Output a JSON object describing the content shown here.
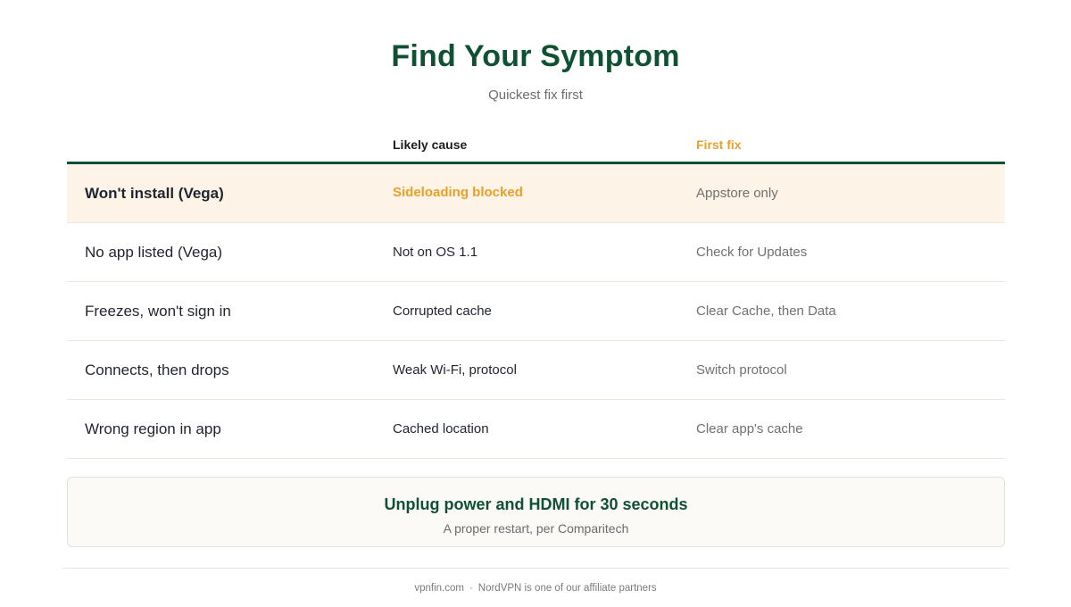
{
  "header": {
    "title": "Find Your Symptom",
    "subtitle": "Quickest fix first"
  },
  "table": {
    "columns": [
      "",
      "Likely cause",
      "First fix"
    ],
    "rows": [
      {
        "symptom": "Won't install (Vega)",
        "cause": "Sideloading blocked",
        "fix": "Appstore only",
        "highlighted": true
      },
      {
        "symptom": "No app listed (Vega)",
        "cause": "Not on OS 1.1",
        "fix": "Check for Updates"
      },
      {
        "symptom": "Freezes, won't sign in",
        "cause": "Corrupted cache",
        "fix": "Clear Cache, then Data"
      },
      {
        "symptom": "Connects, then drops",
        "cause": "Weak Wi-Fi, protocol",
        "fix": "Switch protocol"
      },
      {
        "symptom": "Wrong region in app",
        "cause": "Cached location",
        "fix": "Clear app's cache"
      }
    ]
  },
  "callout": {
    "title": "Unplug power and HDMI for 30 seconds",
    "subtitle": "A proper restart, per Comparitech"
  },
  "footer": {
    "site": "vpnfin.com",
    "separator": "·",
    "note": "NordVPN is one of our affiliate partners"
  },
  "colors": {
    "brand_green": "#0f5132",
    "accent_orange": "#e8a02a",
    "highlight_row": "#fdf3e6"
  }
}
